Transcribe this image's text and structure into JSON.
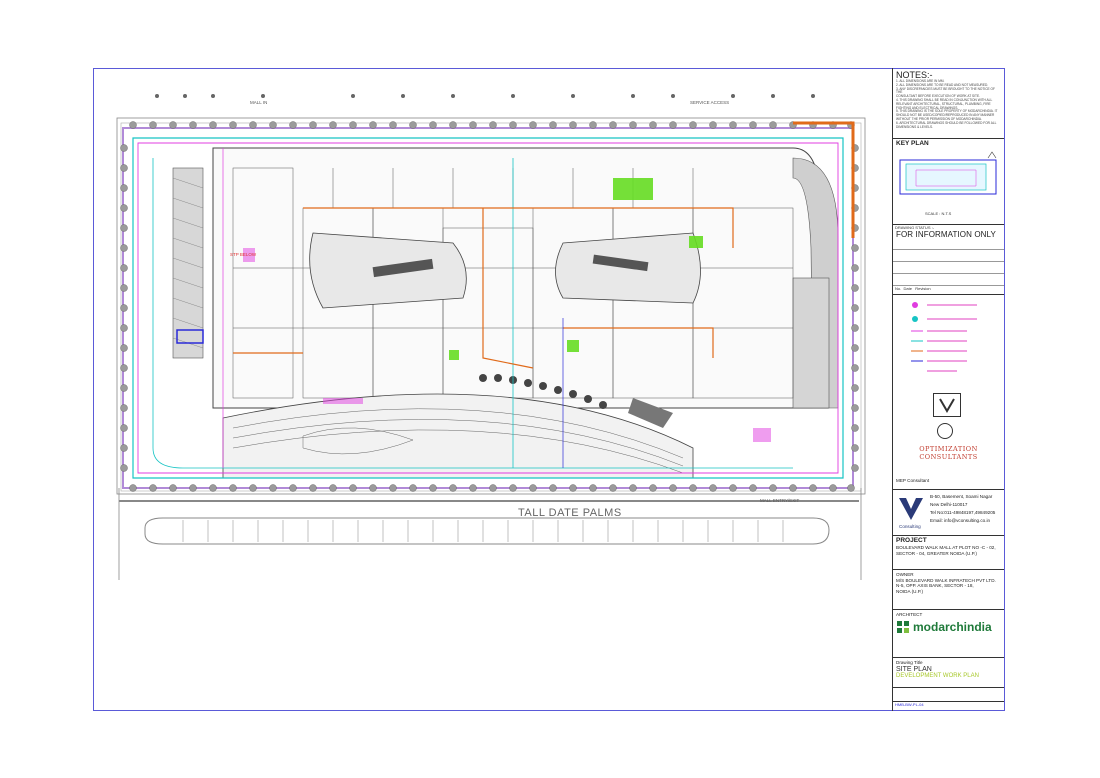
{
  "notes": {
    "title": "NOTES:-",
    "lines": [
      "1. ALL DIMENSIONS ARE IN MM.",
      "2. ALL DIMENSIONS ARE TO BE READ AND NOT MEASURED.",
      "3. ANY DISCREPANCIES MUST BE BROUGHT TO THE NOTICE OF THE",
      "CONSULTANT BEFORE EXECUTION OF WORK AT SITE.",
      "4. THIS DRAWING SHALL BE READ IN CONJUNCTION WITH ALL",
      "RELEVANT ARCHITECTURAL, STRUCTURAL, PLUMBING, FIRE",
      "FIGHTING AND ELECTRICAL DRAWINGS.",
      "5. THIS DRAWING IS THE SOLE PROPERTY OF MODARCHINDIA. IT",
      "SHOULD NOT BE USED/COPIED/REPRODUCED IN ANY MANNER",
      "WITHOUT THE PRIOR PERMISSION OF MODARCHINDIA.",
      "6. ARCHITECTURAL DRAWINGS SHOULD BE FOLLOWED FOR ALL",
      "DIMENSIONS & LEVELS."
    ]
  },
  "key_plan": {
    "title": "KEY PLAN",
    "scale": "SCALE : N.T.S"
  },
  "drawing_status": {
    "label": "DRAWING STATUS :-",
    "value": "FOR INFORMATION ONLY"
  },
  "revision": {
    "no": "No.",
    "date": "Date",
    "revision": "Revision"
  },
  "consultants": {
    "firm_name": "OPTIMIZATION CONSULTANTS",
    "mep_label": "MEP Consultant",
    "v_address_1": "B-50, Basement, Soami Nagar",
    "v_address_2": "New Delhi-110017",
    "v_tel": "Tel No:011-49848197,49849205",
    "v_email": "Email: info@vconsulting.co.in",
    "v_name": "Consulting"
  },
  "project": {
    "label": "PROJECT",
    "line1": "BOULEVARD WALK MALL AT PLOT NO -C - 02,",
    "line2": "SECTOR - 04, GREATER NOIDA (U.P.)"
  },
  "owner": {
    "label": "OWNER",
    "line1": "M/S BOULEVARD WALK INFRATECH PVT LTD.",
    "line2": "N-5, OPP. AXIS BANK, SECTOR - 18,",
    "line3": "NOIDA (U.P.)"
  },
  "architect": {
    "label": "ARCHITECT",
    "name": "modarchindia"
  },
  "drawing_title": {
    "label": "Drawing Title",
    "line1": "SITE PLAN",
    "line2": "DEVELOPMENT WORK PLAN"
  },
  "drawing_no": {
    "value": "HMB-BW-PL-04"
  },
  "plan_labels": {
    "tall_date_palms": "TALL DATE PALMS",
    "service_access": "SERVICE ACCESS",
    "mall_in": "MALL IN",
    "stp_below": "STP BELOW",
    "mall_entry_exit": "MALL ENTRY/EXIT"
  },
  "colors": {
    "cyan": "#16c4c4",
    "magenta": "#e03ce0",
    "orange": "#e06a1a",
    "green": "#66dd22",
    "blue": "#2a2ad8",
    "gray": "#8a8a8a"
  }
}
